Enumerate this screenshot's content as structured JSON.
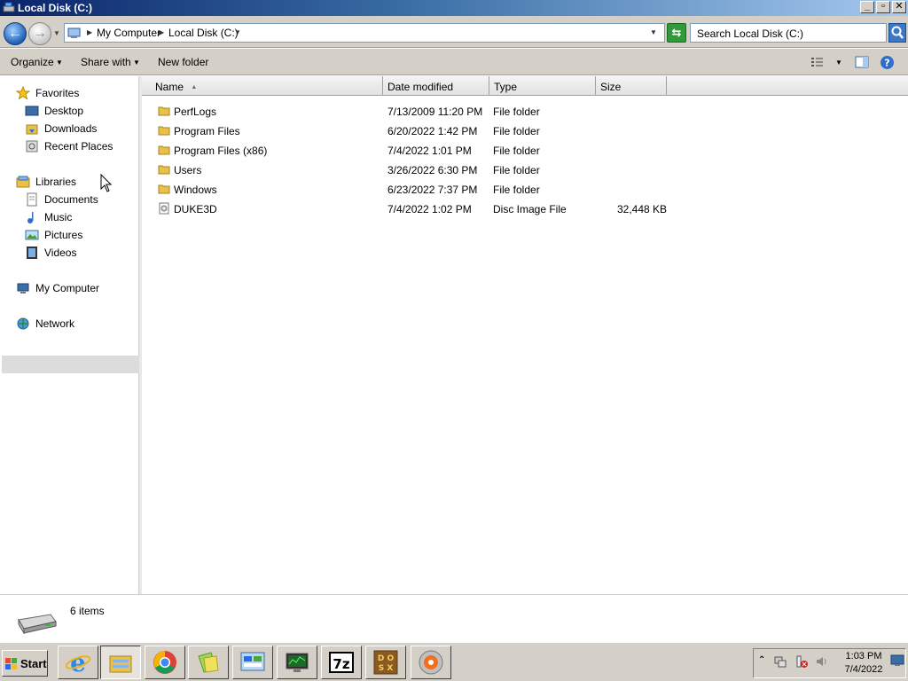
{
  "window": {
    "title": "Local Disk (C:)"
  },
  "address": {
    "crumbs": [
      "My Computer",
      "Local Disk (C:)"
    ],
    "search_placeholder": "Search Local Disk (C:)"
  },
  "toolbar": {
    "organize": "Organize",
    "share_with": "Share with",
    "new_folder": "New folder"
  },
  "nav": {
    "favorites": {
      "label": "Favorites",
      "items": [
        "Desktop",
        "Downloads",
        "Recent Places"
      ]
    },
    "libraries": {
      "label": "Libraries",
      "items": [
        "Documents",
        "Music",
        "Pictures",
        "Videos"
      ]
    },
    "computer": "My Computer",
    "network": "Network"
  },
  "columns": {
    "name": "Name",
    "date": "Date modified",
    "type": "Type",
    "size": "Size"
  },
  "files": [
    {
      "name": "PerfLogs",
      "date": "7/13/2009 11:20 PM",
      "type": "File folder",
      "size": "",
      "icon": "folder-icon"
    },
    {
      "name": "Program Files",
      "date": "6/20/2022 1:42 PM",
      "type": "File folder",
      "size": "",
      "icon": "folder-icon"
    },
    {
      "name": "Program Files (x86)",
      "date": "7/4/2022 1:01 PM",
      "type": "File folder",
      "size": "",
      "icon": "folder-icon"
    },
    {
      "name": "Users",
      "date": "3/26/2022 6:30 PM",
      "type": "File folder",
      "size": "",
      "icon": "folder-icon"
    },
    {
      "name": "Windows",
      "date": "6/23/2022 7:37 PM",
      "type": "File folder",
      "size": "",
      "icon": "folder-icon"
    },
    {
      "name": "DUKE3D",
      "date": "7/4/2022 1:02 PM",
      "type": "Disc Image File",
      "size": "32,448 KB",
      "icon": "disc-image-icon"
    }
  ],
  "details": {
    "count": "6 items"
  },
  "taskbar": {
    "start": "Start",
    "apps": [
      "internet-explorer-icon",
      "windows-explorer-icon",
      "chrome-icon",
      "sticky-folders-icon",
      "control-panel-icon",
      "monitor-icon",
      "7zip-icon",
      "dosbox-icon",
      "media-player-icon"
    ],
    "time": "1:03 PM",
    "date": "7/4/2022"
  },
  "colors": {
    "title_gradient_start": "#0a246a",
    "selection": "#dcdcdc",
    "folder": "#e8c04a"
  }
}
